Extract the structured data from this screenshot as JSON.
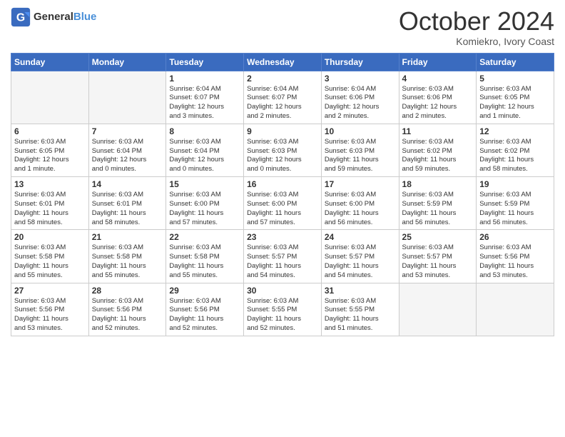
{
  "header": {
    "logo_line1": "General",
    "logo_line2": "Blue",
    "month": "October 2024",
    "location": "Komiekro, Ivory Coast"
  },
  "days_of_week": [
    "Sunday",
    "Monday",
    "Tuesday",
    "Wednesday",
    "Thursday",
    "Friday",
    "Saturday"
  ],
  "weeks": [
    [
      {
        "num": "",
        "info": ""
      },
      {
        "num": "",
        "info": ""
      },
      {
        "num": "1",
        "info": "Sunrise: 6:04 AM\nSunset: 6:07 PM\nDaylight: 12 hours\nand 3 minutes."
      },
      {
        "num": "2",
        "info": "Sunrise: 6:04 AM\nSunset: 6:07 PM\nDaylight: 12 hours\nand 2 minutes."
      },
      {
        "num": "3",
        "info": "Sunrise: 6:04 AM\nSunset: 6:06 PM\nDaylight: 12 hours\nand 2 minutes."
      },
      {
        "num": "4",
        "info": "Sunrise: 6:03 AM\nSunset: 6:06 PM\nDaylight: 12 hours\nand 2 minutes."
      },
      {
        "num": "5",
        "info": "Sunrise: 6:03 AM\nSunset: 6:05 PM\nDaylight: 12 hours\nand 1 minute."
      }
    ],
    [
      {
        "num": "6",
        "info": "Sunrise: 6:03 AM\nSunset: 6:05 PM\nDaylight: 12 hours\nand 1 minute."
      },
      {
        "num": "7",
        "info": "Sunrise: 6:03 AM\nSunset: 6:04 PM\nDaylight: 12 hours\nand 0 minutes."
      },
      {
        "num": "8",
        "info": "Sunrise: 6:03 AM\nSunset: 6:04 PM\nDaylight: 12 hours\nand 0 minutes."
      },
      {
        "num": "9",
        "info": "Sunrise: 6:03 AM\nSunset: 6:03 PM\nDaylight: 12 hours\nand 0 minutes."
      },
      {
        "num": "10",
        "info": "Sunrise: 6:03 AM\nSunset: 6:03 PM\nDaylight: 11 hours\nand 59 minutes."
      },
      {
        "num": "11",
        "info": "Sunrise: 6:03 AM\nSunset: 6:02 PM\nDaylight: 11 hours\nand 59 minutes."
      },
      {
        "num": "12",
        "info": "Sunrise: 6:03 AM\nSunset: 6:02 PM\nDaylight: 11 hours\nand 58 minutes."
      }
    ],
    [
      {
        "num": "13",
        "info": "Sunrise: 6:03 AM\nSunset: 6:01 PM\nDaylight: 11 hours\nand 58 minutes."
      },
      {
        "num": "14",
        "info": "Sunrise: 6:03 AM\nSunset: 6:01 PM\nDaylight: 11 hours\nand 58 minutes."
      },
      {
        "num": "15",
        "info": "Sunrise: 6:03 AM\nSunset: 6:00 PM\nDaylight: 11 hours\nand 57 minutes."
      },
      {
        "num": "16",
        "info": "Sunrise: 6:03 AM\nSunset: 6:00 PM\nDaylight: 11 hours\nand 57 minutes."
      },
      {
        "num": "17",
        "info": "Sunrise: 6:03 AM\nSunset: 6:00 PM\nDaylight: 11 hours\nand 56 minutes."
      },
      {
        "num": "18",
        "info": "Sunrise: 6:03 AM\nSunset: 5:59 PM\nDaylight: 11 hours\nand 56 minutes."
      },
      {
        "num": "19",
        "info": "Sunrise: 6:03 AM\nSunset: 5:59 PM\nDaylight: 11 hours\nand 56 minutes."
      }
    ],
    [
      {
        "num": "20",
        "info": "Sunrise: 6:03 AM\nSunset: 5:58 PM\nDaylight: 11 hours\nand 55 minutes."
      },
      {
        "num": "21",
        "info": "Sunrise: 6:03 AM\nSunset: 5:58 PM\nDaylight: 11 hours\nand 55 minutes."
      },
      {
        "num": "22",
        "info": "Sunrise: 6:03 AM\nSunset: 5:58 PM\nDaylight: 11 hours\nand 55 minutes."
      },
      {
        "num": "23",
        "info": "Sunrise: 6:03 AM\nSunset: 5:57 PM\nDaylight: 11 hours\nand 54 minutes."
      },
      {
        "num": "24",
        "info": "Sunrise: 6:03 AM\nSunset: 5:57 PM\nDaylight: 11 hours\nand 54 minutes."
      },
      {
        "num": "25",
        "info": "Sunrise: 6:03 AM\nSunset: 5:57 PM\nDaylight: 11 hours\nand 53 minutes."
      },
      {
        "num": "26",
        "info": "Sunrise: 6:03 AM\nSunset: 5:56 PM\nDaylight: 11 hours\nand 53 minutes."
      }
    ],
    [
      {
        "num": "27",
        "info": "Sunrise: 6:03 AM\nSunset: 5:56 PM\nDaylight: 11 hours\nand 53 minutes."
      },
      {
        "num": "28",
        "info": "Sunrise: 6:03 AM\nSunset: 5:56 PM\nDaylight: 11 hours\nand 52 minutes."
      },
      {
        "num": "29",
        "info": "Sunrise: 6:03 AM\nSunset: 5:56 PM\nDaylight: 11 hours\nand 52 minutes."
      },
      {
        "num": "30",
        "info": "Sunrise: 6:03 AM\nSunset: 5:55 PM\nDaylight: 11 hours\nand 52 minutes."
      },
      {
        "num": "31",
        "info": "Sunrise: 6:03 AM\nSunset: 5:55 PM\nDaylight: 11 hours\nand 51 minutes."
      },
      {
        "num": "",
        "info": ""
      },
      {
        "num": "",
        "info": ""
      }
    ]
  ]
}
